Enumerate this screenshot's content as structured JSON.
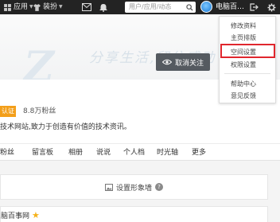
{
  "topbar": {
    "apps_label": "应用",
    "dress_label": "装扮",
    "search_placeholder": "用户/应用/动态",
    "username": "电脑百…"
  },
  "banner": {
    "watermark_text": "分享生活,留住感动",
    "unfollow_label": "取消关注"
  },
  "menu": {
    "items": [
      "修改资料",
      "主页排版",
      "空间设置",
      "权限设置",
      "帮助中心",
      "意见反馈"
    ],
    "highlighted_index": 2,
    "highlight_color": "#e0262d"
  },
  "profile": {
    "badge_label": "认证",
    "fans": "8.8万粉丝",
    "description": "技术网站,致力于创造有价值的技术资讯。"
  },
  "nav": {
    "items": [
      "粉丝",
      "留言板",
      "相册",
      "说说",
      "个人档",
      "时光轴",
      "更多"
    ]
  },
  "content": {
    "set_image_label": "设置形象墙",
    "bottom_name": "脑百事网"
  },
  "colors": {
    "topbar": "#232323",
    "accent_orange": "#f39f1a",
    "button_dark": "#555a60"
  }
}
